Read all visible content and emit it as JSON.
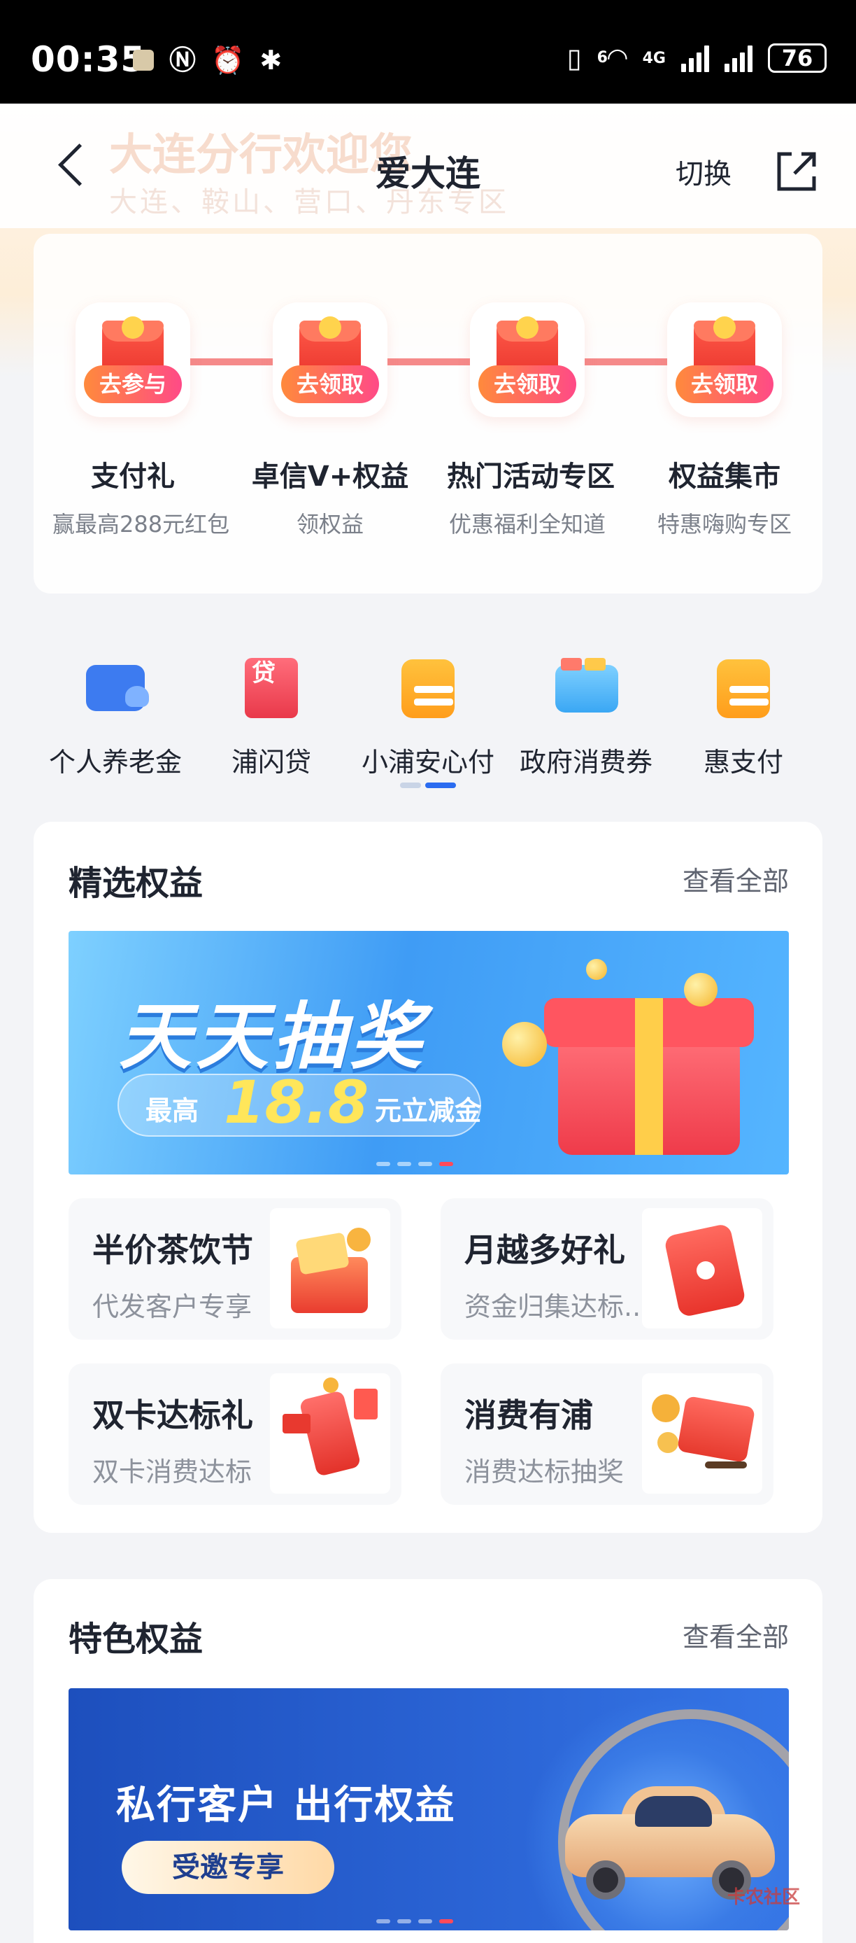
{
  "status_bar": {
    "time": "00:35",
    "network_type": "4G",
    "wifi_badge": "6",
    "battery": "76"
  },
  "header": {
    "title": "爱大连",
    "switch_label": "切换",
    "background_title": "大连分行欢迎您",
    "background_subtitle": "大连、鞍山、营口、丹东专区"
  },
  "activities": [
    {
      "tag": "去参与",
      "name": "支付礼",
      "desc": "赢最高288元红包"
    },
    {
      "tag": "去领取",
      "name": "卓信V+权益",
      "desc": "领权益"
    },
    {
      "tag": "去领取",
      "name": "热门活动专区",
      "desc": "优惠福利全知道"
    },
    {
      "tag": "去领取",
      "name": "权益集市",
      "desc": "特惠嗨购专区"
    }
  ],
  "quick_entries": [
    {
      "label": "个人养老金",
      "icon": "wallet-heart-icon"
    },
    {
      "label": "浦闪贷",
      "icon": "loan-icon",
      "glyph": "贷"
    },
    {
      "label": "小浦安心付",
      "icon": "card-icon"
    },
    {
      "label": "政府消费券",
      "icon": "voucher-wallet-icon"
    },
    {
      "label": "惠支付",
      "icon": "card-icon"
    }
  ],
  "featured": {
    "title": "精选权益",
    "more": "查看全部",
    "banner": {
      "headline": "天天抽奖",
      "prefix": "最高",
      "amount": "18.8",
      "suffix": "元立减金"
    },
    "tiles": [
      {
        "title": "半价茶饮节",
        "desc": "代发客户专享"
      },
      {
        "title": "月越多好礼",
        "desc": "资金归集达标..."
      },
      {
        "title": "双卡达标礼",
        "desc": "双卡消费达标"
      },
      {
        "title": "消费有浦",
        "desc": "消费达标抽奖"
      }
    ]
  },
  "special": {
    "title": "特色权益",
    "more": "查看全部",
    "banner": {
      "headline": "私行客户 出行权益",
      "cta": "受邀专享"
    }
  },
  "watermark": "卡农社区",
  "colors": {
    "accent_blue": "#2b6cf0",
    "accent_red": "#ff4a5a",
    "tag_gradient_start": "#ff8a3c",
    "tag_gradient_end": "#ff4a87"
  }
}
